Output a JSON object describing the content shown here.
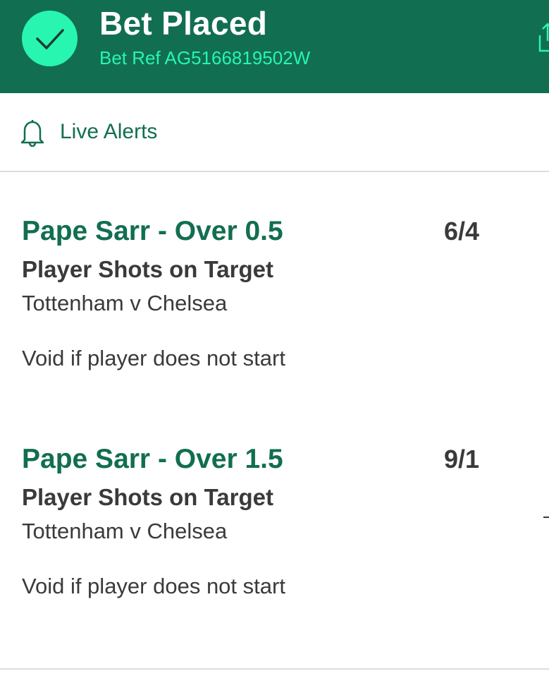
{
  "header": {
    "title": "Bet Placed",
    "bet_ref": "Bet Ref AG5166819502W",
    "status_icon": "check-icon",
    "action_icon": "share-icon"
  },
  "alerts": {
    "label": "Live Alerts",
    "icon": "bell-icon"
  },
  "bets": [
    {
      "selection": "Pape Sarr - Over 0.5",
      "odds": "6/4",
      "market": "Player Shots on Target",
      "event": "Tottenham v Chelsea",
      "note": "Void if player does not start"
    },
    {
      "selection": "Pape Sarr - Over 1.5",
      "odds": "9/1",
      "market": "Player Shots on Target",
      "event": "Tottenham v Chelsea",
      "note": "Void if player does not start"
    }
  ],
  "colors": {
    "brand_green": "#126e51",
    "accent_mint": "#27f5b0",
    "text_dark": "#3a3a3a",
    "divider": "#dcdcdc"
  }
}
